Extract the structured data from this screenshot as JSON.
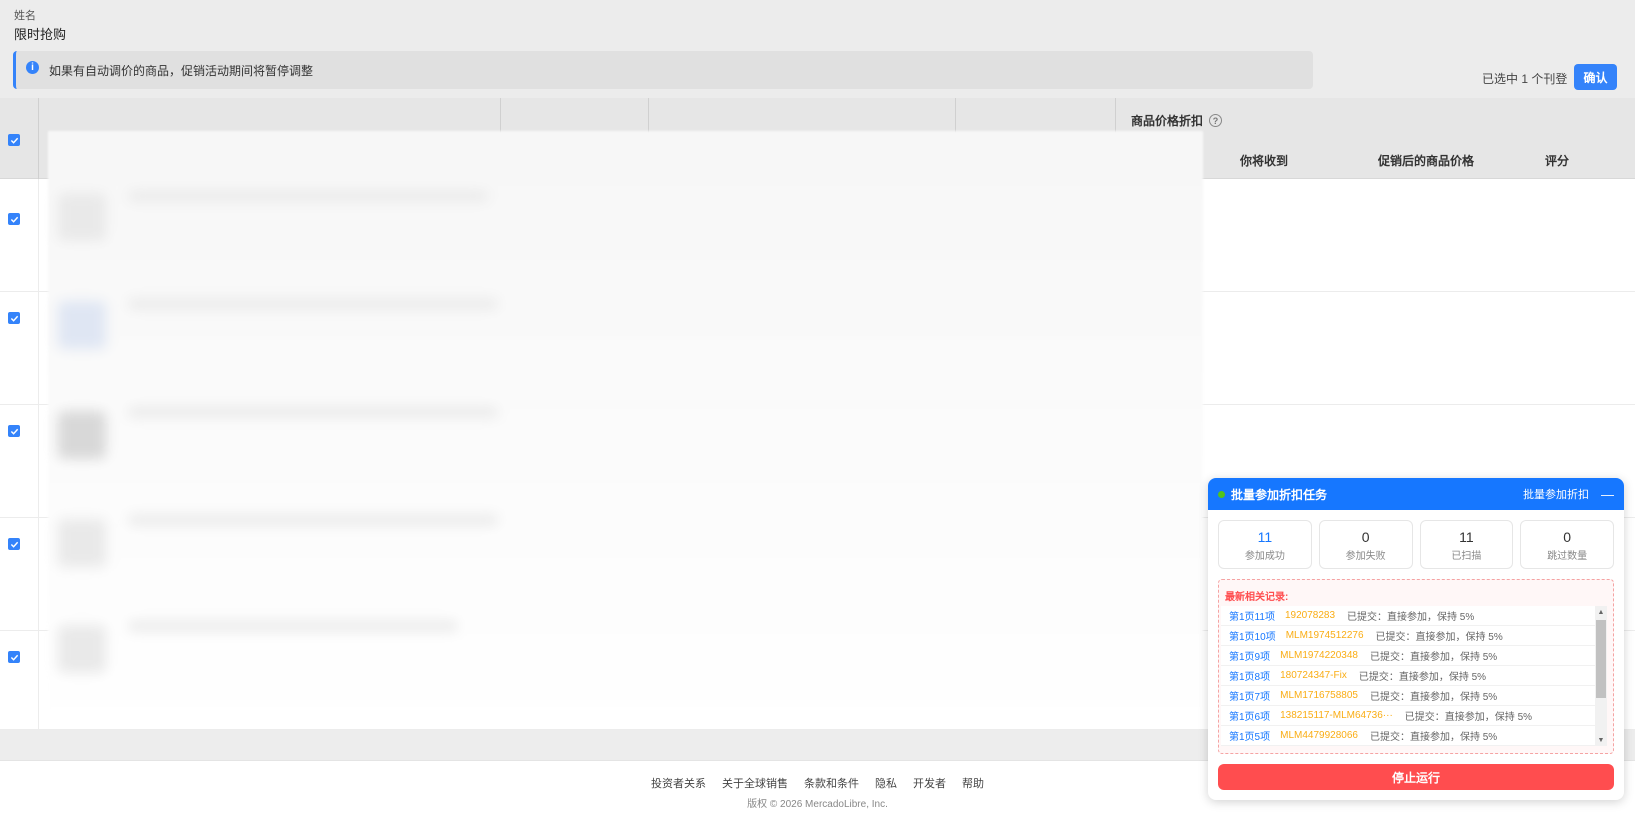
{
  "top": {
    "name_label": "姓名",
    "name_value": "限时抢购",
    "notice": "如果有自动调价的商品，促销活动期间将暂停调整",
    "notice_icon": "info-icon",
    "selected_count": "已选中 1 个刊登",
    "confirm_label": "确认"
  },
  "table": {
    "group_header": "商品价格折扣",
    "columns": [
      "你将收到",
      "促销后的商品价格",
      "评分"
    ]
  },
  "footer": {
    "links": [
      "投资者关系",
      "关于全球销售",
      "条款和条件",
      "隐私",
      "开发者",
      "帮助"
    ],
    "copyright": "版权 © 2026 MercadoLibre, Inc."
  },
  "panel": {
    "title": "批量参加折扣任务",
    "mode": "批量参加折扣",
    "minimize": "—",
    "stats": [
      {
        "value": "11",
        "label": "参加成功"
      },
      {
        "value": "0",
        "label": "参加失败"
      },
      {
        "value": "11",
        "label": "已扫描"
      },
      {
        "value": "0",
        "label": "跳过数量"
      }
    ],
    "records_title": "最新相关记录:",
    "records": [
      {
        "page": "第1页11项",
        "id": "192078283",
        "status": "已提交：直接参加，保持 5%"
      },
      {
        "page": "第1页10项",
        "id": "MLM1974512276",
        "status": "已提交：直接参加，保持 5%"
      },
      {
        "page": "第1页9项",
        "id": "MLM1974220348",
        "status": "已提交：直接参加，保持 5%"
      },
      {
        "page": "第1页8项",
        "id": "180724347-Fix",
        "status": "已提交：直接参加，保持 5%"
      },
      {
        "page": "第1页7项",
        "id": "MLM1716758805",
        "status": "已提交：直接参加，保持 5%"
      },
      {
        "page": "第1页6项",
        "id": "138215117-MLM64736···",
        "status": "已提交：直接参加，保持 5%"
      },
      {
        "page": "第1页5项",
        "id": "MLM4479928066",
        "status": "已提交：直接参加，保持 5%"
      }
    ],
    "stop_label": "停止运行"
  }
}
